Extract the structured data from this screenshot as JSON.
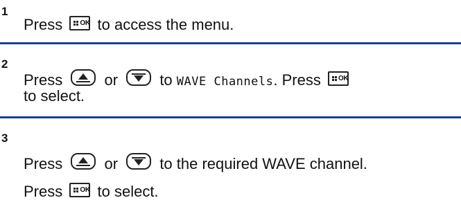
{
  "steps": [
    {
      "number": "1",
      "lines": [
        {
          "press": "Press",
          "after": "to access the menu."
        }
      ]
    },
    {
      "number": "2",
      "lines": [
        {
          "press": "Press",
          "or": "or",
          "to": "to",
          "display_text": "WAVE Channels",
          "period_press": ". Press"
        },
        {
          "text": "to select."
        }
      ]
    },
    {
      "number": "3",
      "lines": [
        {
          "press": "Press",
          "or": "or",
          "after": "to the required WAVE channel."
        },
        {
          "press": "Press",
          "after": "to select."
        }
      ]
    }
  ],
  "icons": {
    "menu_ok_label": "OK",
    "menu_ok_icon": "menu-ok-key-icon",
    "up_icon": "up-navigation-key-icon",
    "down_icon": "down-navigation-key-icon"
  },
  "colors": {
    "divider": "#1b3f93",
    "text": "#111111"
  }
}
